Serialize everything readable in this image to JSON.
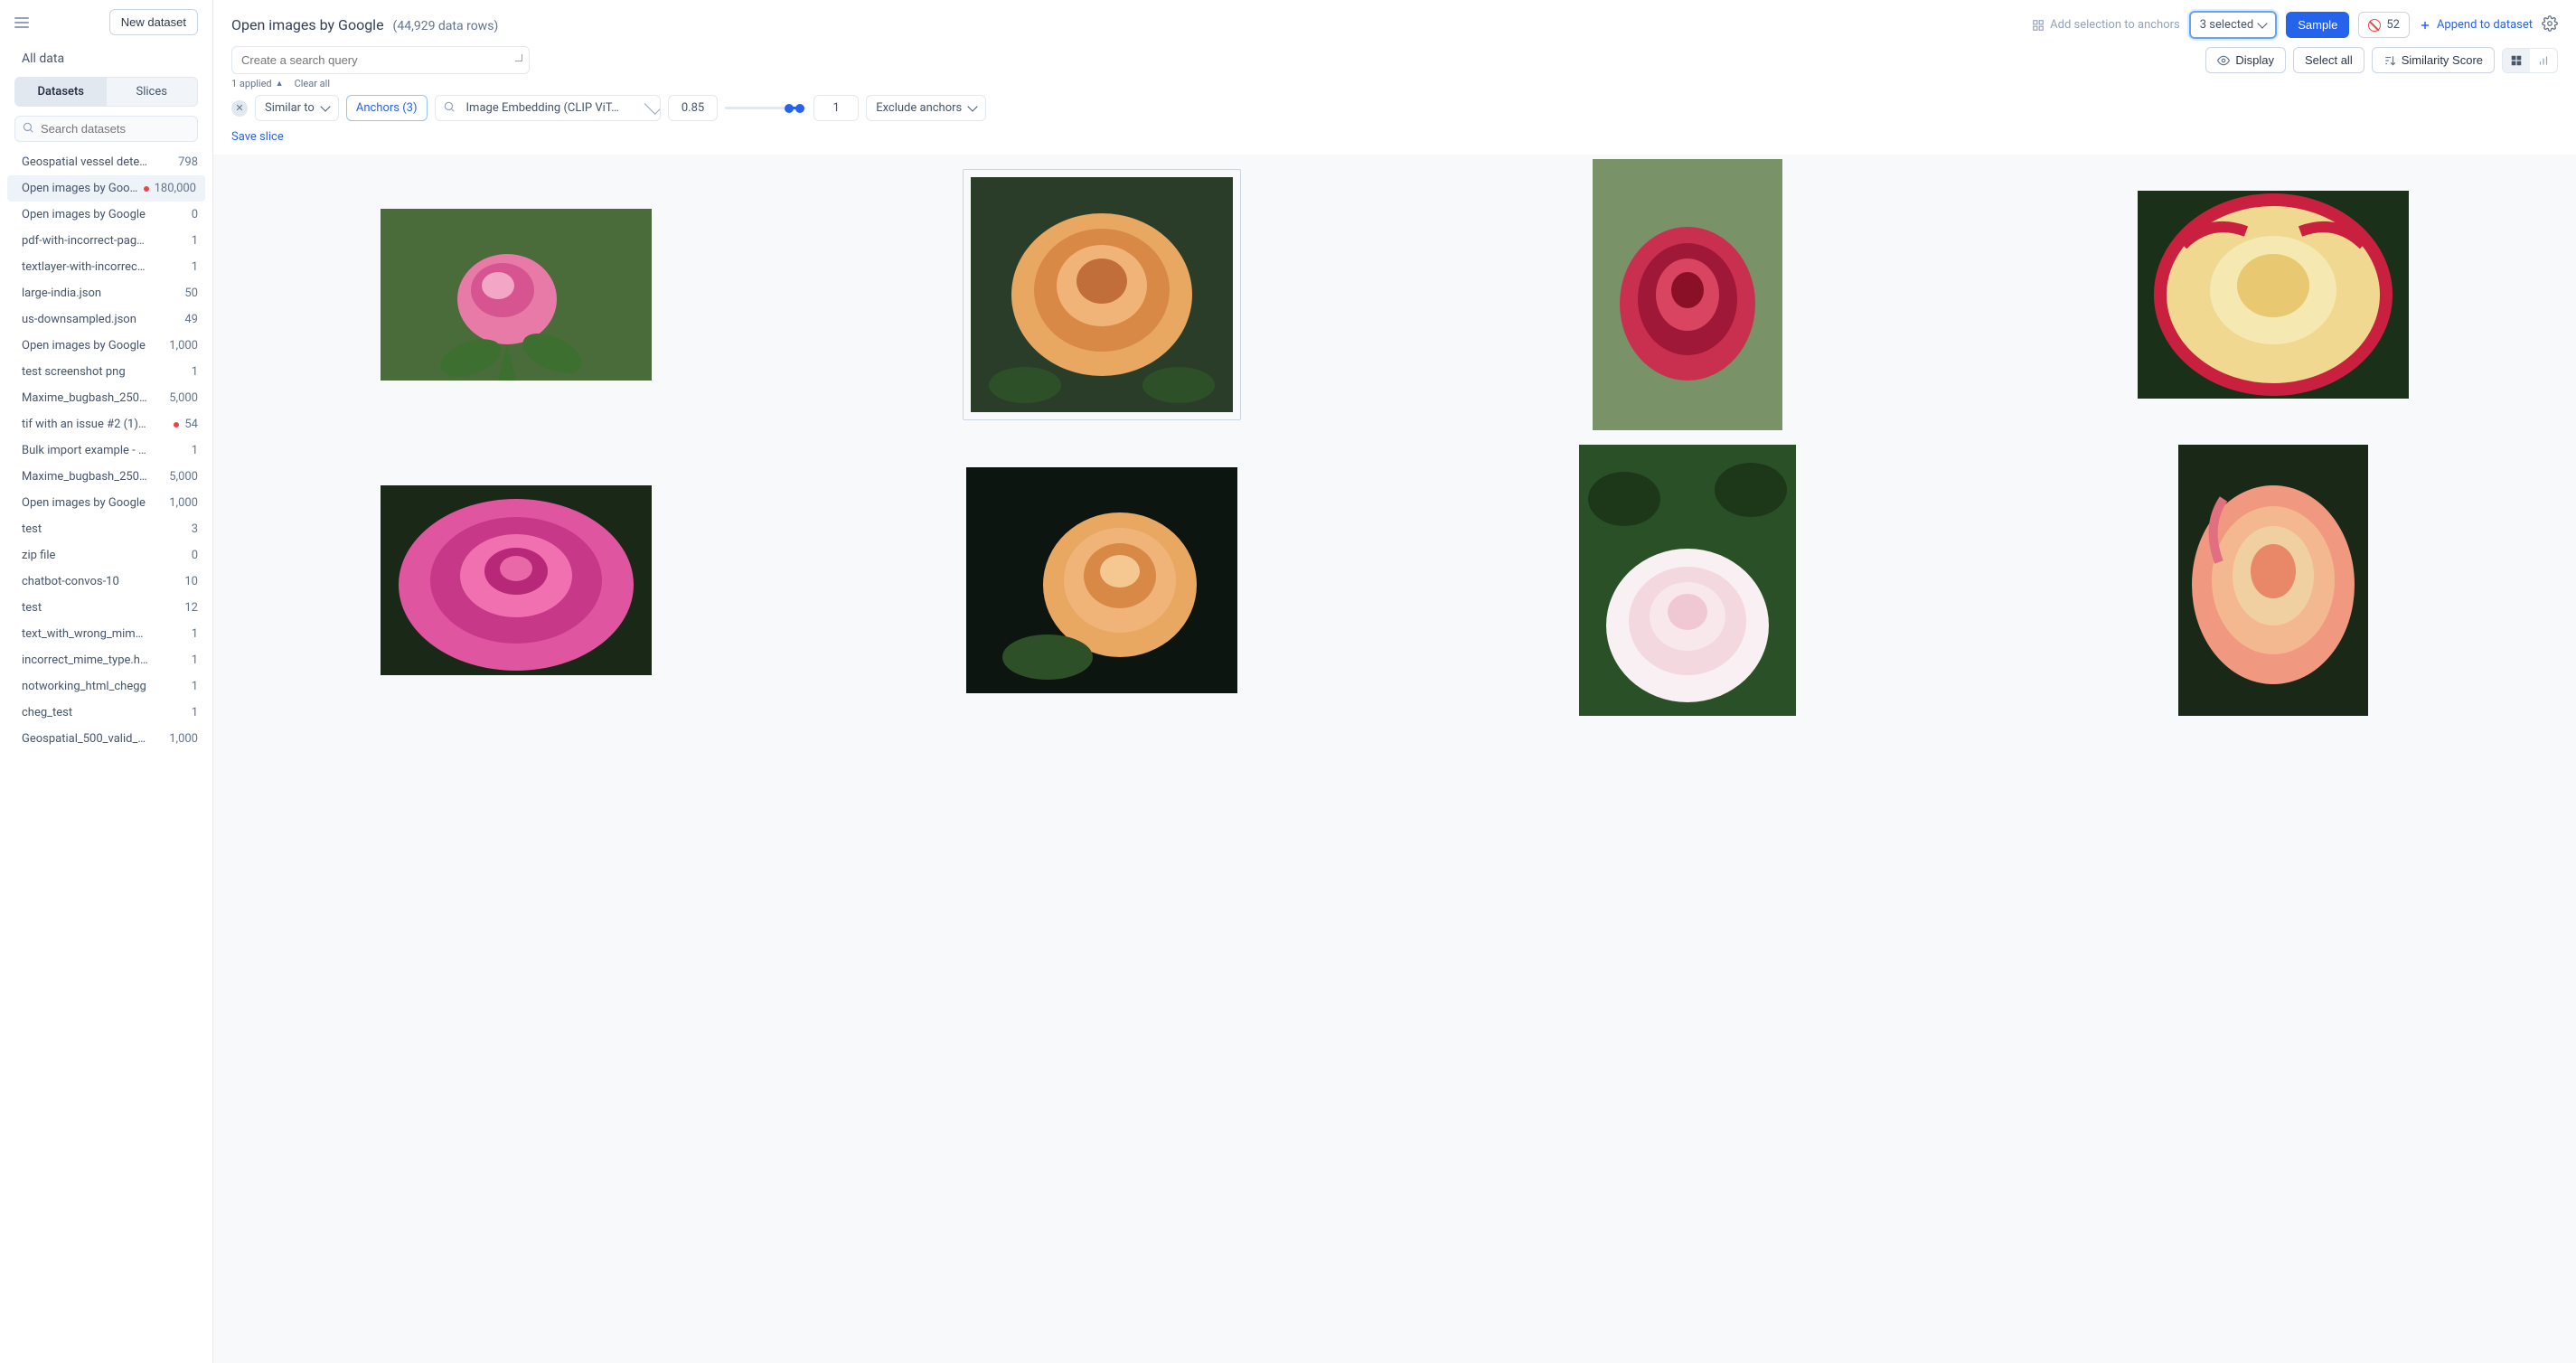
{
  "sidebar": {
    "new_dataset_label": "New dataset",
    "all_data_label": "All data",
    "tabs": {
      "datasets": "Datasets",
      "slices": "Slices"
    },
    "search_placeholder": "Search datasets",
    "items": [
      {
        "name": "Geospatial vessel detecti…",
        "count": "798",
        "red": false,
        "active": false
      },
      {
        "name": "Open images by Goo…",
        "count": "180,000",
        "red": true,
        "active": true
      },
      {
        "name": "Open images by Google",
        "count": "0",
        "red": false,
        "active": false
      },
      {
        "name": "pdf-with-incorrect-page-nu…",
        "count": "1",
        "red": false,
        "active": false
      },
      {
        "name": "textlayer-with-incorrect-pa…",
        "count": "1",
        "red": false,
        "active": false
      },
      {
        "name": "large-india.json",
        "count": "50",
        "red": false,
        "active": false
      },
      {
        "name": "us-downsampled.json",
        "count": "49",
        "red": false,
        "active": false
      },
      {
        "name": "Open images by Google",
        "count": "1,000",
        "red": false,
        "active": false
      },
      {
        "name": "test screenshot png",
        "count": "1",
        "red": false,
        "active": false
      },
      {
        "name": "Maxime_bugbash_250…",
        "count": "5,000",
        "red": false,
        "active": false
      },
      {
        "name": "tif with an issue #2 (1).json",
        "count": "54",
        "red": true,
        "active": false
      },
      {
        "name": "Bulk import example - Geos…",
        "count": "1",
        "red": false,
        "active": false
      },
      {
        "name": "Maxime_bugbash_250…",
        "count": "5,000",
        "red": false,
        "active": false
      },
      {
        "name": "Open images by Google",
        "count": "1,000",
        "red": false,
        "active": false
      },
      {
        "name": "test",
        "count": "3",
        "red": false,
        "active": false
      },
      {
        "name": "zip file",
        "count": "0",
        "red": false,
        "active": false
      },
      {
        "name": "chatbot-convos-10",
        "count": "10",
        "red": false,
        "active": false
      },
      {
        "name": "test",
        "count": "12",
        "red": false,
        "active": false
      },
      {
        "name": "text_with_wrong_mime_type",
        "count": "1",
        "red": false,
        "active": false
      },
      {
        "name": "incorrect_mime_type.html",
        "count": "1",
        "red": false,
        "active": false
      },
      {
        "name": "notworking_html_chegg",
        "count": "1",
        "red": false,
        "active": false
      },
      {
        "name": "cheg_test",
        "count": "1",
        "red": false,
        "active": false
      },
      {
        "name": "Geospatial_500_valid_…",
        "count": "1,000",
        "red": false,
        "active": false
      }
    ]
  },
  "header": {
    "title": "Open images by Google",
    "subtitle": "(44,929 data rows)",
    "add_selection_label": "Add selection to anchors",
    "selected_label": "3 selected",
    "sample_label": "Sample",
    "blocked_count": "52",
    "append_label": "Append to dataset"
  },
  "toolbar": {
    "search_placeholder": "Create a search query",
    "display_label": "Display",
    "select_all_label": "Select all",
    "similarity_label": "Similarity Score"
  },
  "applied": {
    "applied_label": "1 applied",
    "clear_label": "Clear all"
  },
  "filter": {
    "similar_to_label": "Similar to",
    "anchors_label": "Anchors (3)",
    "embedding_label": "Image Embedding (CLIP ViT…",
    "threshold_value": "0.85",
    "count_value": "1",
    "exclude_label": "Exclude anchors"
  },
  "save_slice_label": "Save slice"
}
